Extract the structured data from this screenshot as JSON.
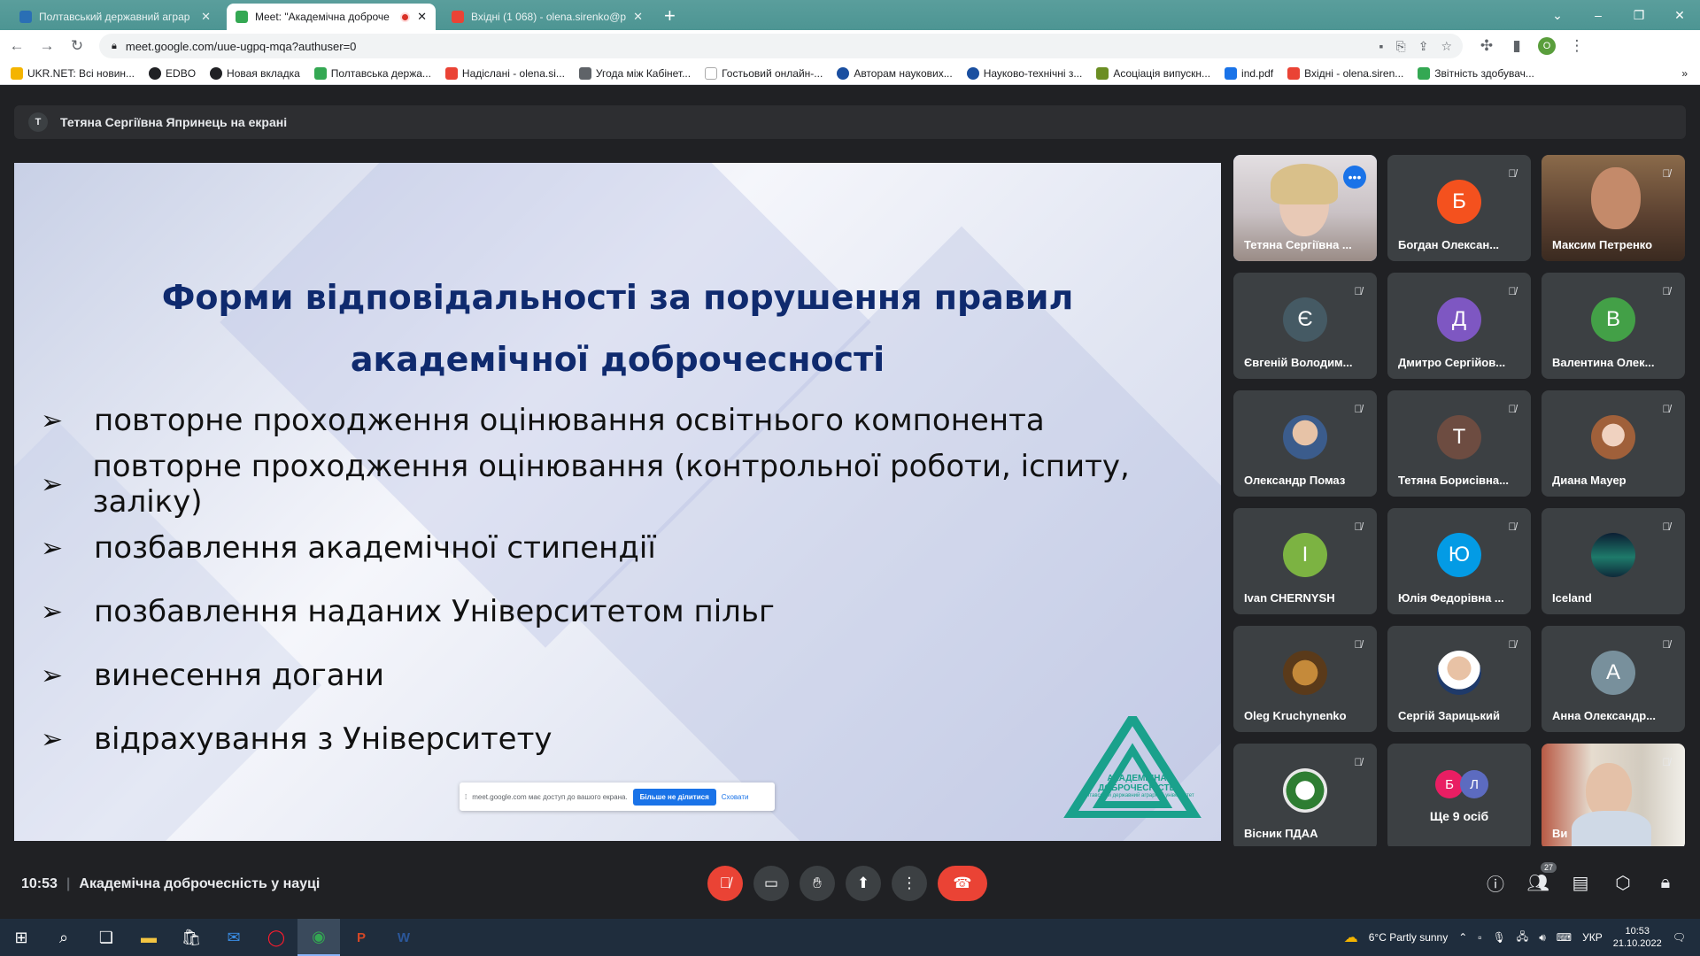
{
  "browser": {
    "tabs": [
      {
        "title": "Полтавський державний аграр",
        "active": false,
        "favicon_color": "#2a6fb5"
      },
      {
        "title": "Meet: \"Академічна доброче",
        "active": true,
        "favicon_color": "#34a853",
        "recording": true
      },
      {
        "title": "Вхідні (1 068) - olena.sirenko@p",
        "active": false,
        "favicon_color": "#ea4335"
      }
    ],
    "new_tab": "+",
    "window_controls": [
      "–",
      "❐",
      "✕"
    ],
    "url": "meet.google.com/uue-ugpq-mqa?authuser=0",
    "profile_initial": "O",
    "bookmarks": [
      {
        "label": "UKR.NET: Всі новин...",
        "color": "#f4b400"
      },
      {
        "label": "EDBO",
        "color": "#202124"
      },
      {
        "label": "Новая вкладка",
        "color": "#202124"
      },
      {
        "label": "Полтавська держа...",
        "color": "#34a853"
      },
      {
        "label": "Надіслані - olena.si...",
        "color": "#ea4335"
      },
      {
        "label": "Угода між Кабінет...",
        "color": "#5f6368"
      },
      {
        "label": "Гостьовий онлайн-...",
        "color": "#1a73e8"
      },
      {
        "label": "Авторам наукових...",
        "color": "#1a4fa0"
      },
      {
        "label": "Науково-технічні з...",
        "color": "#1a4fa0"
      },
      {
        "label": "Асоціація випускн...",
        "color": "#6b8e23"
      },
      {
        "label": "ind.pdf",
        "color": "#1a73e8"
      },
      {
        "label": "Вхідні - olena.siren...",
        "color": "#ea4335"
      },
      {
        "label": "Звітність здобувач...",
        "color": "#34a853"
      }
    ]
  },
  "meet": {
    "presenter_banner": "Тетяна Сергіївна Япринець на екрані",
    "presenter_initial": "T",
    "slide": {
      "title_line1": "Форми відповідальності за порушення правил",
      "title_line2": "академічної доброчесності",
      "bullets": [
        "повторне проходження оцінювання освітнього компонента",
        "повторне проходження оцінювання (контрольної роботи, іспиту, заліку)",
        "позбавлення академічної стипендії",
        "позбавлення наданих Університетом пільг",
        "винесення догани",
        "відрахування з Університету"
      ],
      "bullet_glyph": "➢",
      "share_notice": "meet.google.com має доступ до вашого екрана.",
      "stop_sharing": "Більше не ділитися",
      "hide": "Сховати",
      "logo_text": "АКАДЕМІЧНА ДОБРОЧЕСНІСТЬ",
      "logo_subtext": "Полтавський державний аграрний університет"
    },
    "participants": [
      {
        "name": "Тетяна Сергіївна ...",
        "type": "video",
        "speaking": true
      },
      {
        "name": "Богдан Олексан...",
        "type": "avatar",
        "initial": "Б",
        "color": "#f4511e"
      },
      {
        "name": "Максим Петренко",
        "type": "video"
      },
      {
        "name": "Євгеній Володим...",
        "type": "avatar",
        "initial": "Є",
        "color": "#455a64"
      },
      {
        "name": "Дмитро Сергійов...",
        "type": "avatar",
        "initial": "Д",
        "color": "#7e57c2"
      },
      {
        "name": "Валентина Олек...",
        "type": "avatar",
        "initial": "В",
        "color": "#43a047"
      },
      {
        "name": "Олександр Помаз",
        "type": "photo"
      },
      {
        "name": "Тетяна Борисівна...",
        "type": "avatar",
        "initial": "Т",
        "color": "#6d4c41"
      },
      {
        "name": "Диана Мауер",
        "type": "photo"
      },
      {
        "name": "Ivan CHERNYSH",
        "type": "avatar",
        "initial": "І",
        "color": "#7cb342"
      },
      {
        "name": "Юлія Федорівна ...",
        "type": "avatar",
        "initial": "Ю",
        "color": "#039be5"
      },
      {
        "name": "Iceland",
        "type": "photo"
      },
      {
        "name": "Oleg Kruchynenko",
        "type": "photo"
      },
      {
        "name": "Сергій Зарицький",
        "type": "photo"
      },
      {
        "name": "Анна Олександр...",
        "type": "avatar",
        "initial": "А",
        "color": "#78909c"
      },
      {
        "name": "Вісник ПДАА",
        "type": "photo"
      },
      {
        "name": "Ще 9 осіб",
        "type": "more",
        "initials": [
          "Б",
          "Л"
        ]
      },
      {
        "name": "Ви",
        "type": "video"
      }
    ],
    "bottom": {
      "time": "10:53",
      "meeting_title": "Академічна доброчесність у науці",
      "participants_count": "27"
    }
  },
  "taskbar": {
    "weather": "6°C  Partly sunny",
    "lang": "УКР",
    "time": "10:53",
    "date": "21.10.2022",
    "notifications": "1"
  }
}
